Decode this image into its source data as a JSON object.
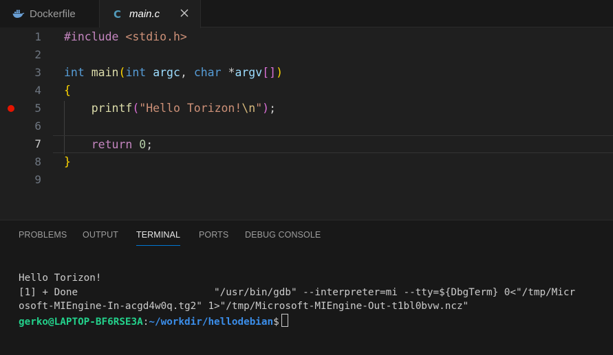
{
  "tabs": [
    {
      "label": "Dockerfile",
      "icon": "docker-icon",
      "active": false
    },
    {
      "label": "main.c",
      "icon": "c-file-icon",
      "icon_text": "C",
      "active": true
    }
  ],
  "editor": {
    "line_numbers": [
      "1",
      "2",
      "3",
      "4",
      "5",
      "6",
      "7",
      "8",
      "9"
    ],
    "current_line": 7,
    "breakpoint_line": 5,
    "line1": {
      "directive": "#include",
      "header": "<stdio.h>"
    },
    "line3": {
      "type1": "int",
      "fn": "main",
      "open": "(",
      "type2": "int",
      "arg1": "argc",
      "comma": ",",
      "type3": "char",
      "star": "*",
      "arg2": "argv",
      "brackets": "[]",
      "close": ")"
    },
    "line4": {
      "brace": "{"
    },
    "line5": {
      "fn": "printf",
      "open": "(",
      "str_a": "\"Hello Torizon!",
      "esc": "\\n",
      "str_b": "\"",
      "close": ")",
      "semi": ";"
    },
    "line7": {
      "kw": "return",
      "num": "0",
      "semi": ";"
    },
    "line8": {
      "brace": "}"
    }
  },
  "panel": {
    "tabs": [
      "PROBLEMS",
      "OUTPUT",
      "TERMINAL",
      "PORTS",
      "DEBUG CONSOLE"
    ],
    "active_tab": "TERMINAL"
  },
  "terminal": {
    "line1": "Hello Torizon!",
    "line2": "[1] + Done                       \"/usr/bin/gdb\" --interpreter=mi --tty=${DbgTerm} 0<\"/tmp/Micr",
    "line3": "osoft-MIEngine-In-acgd4w0q.tg2\" 1>\"/tmp/Microsoft-MIEngine-Out-t1bl0bvw.ncz\"",
    "prompt_user": "gerko@LAPTOP-BF6RSE3A",
    "prompt_sep": ":",
    "prompt_path": "~/workdir/hellodebian",
    "prompt_symbol": "$"
  },
  "colors": {
    "breakpoint": "#e51400",
    "active_tab_underline": "#0078d4",
    "prompt_user": "#23d18b",
    "prompt_path": "#3b8eea"
  }
}
